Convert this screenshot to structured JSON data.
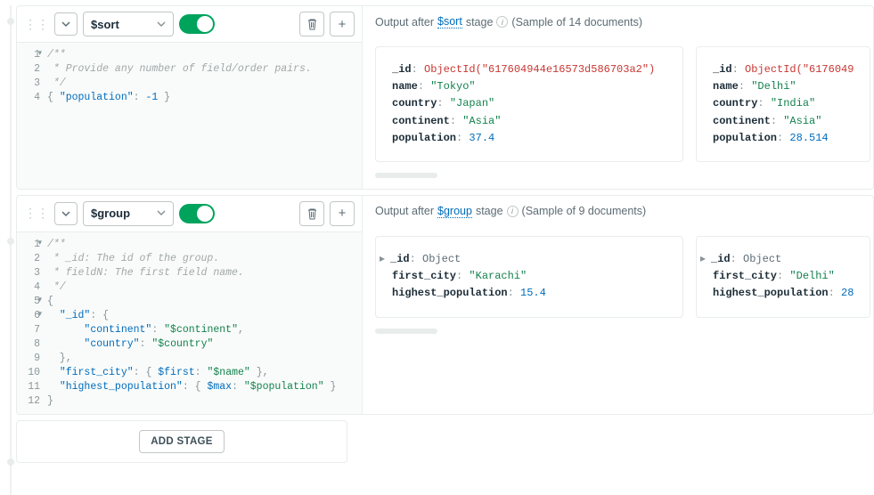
{
  "stages": [
    {
      "operator": "$sort",
      "output_label_prefix": "Output after",
      "output_label_stage": "$sort",
      "output_label_suffix": "stage",
      "sample_text": "(Sample of 14 documents)",
      "code_lines": [
        {
          "n": "1",
          "fold": true,
          "frags": [
            {
              "t": "/**",
              "c": "tok-comment"
            }
          ]
        },
        {
          "n": "2",
          "frags": [
            {
              "t": " * Provide any number of field/order pairs.",
              "c": "tok-comment"
            }
          ]
        },
        {
          "n": "3",
          "frags": [
            {
              "t": " */",
              "c": "tok-comment"
            }
          ]
        },
        {
          "n": "4",
          "frags": [
            {
              "t": "{ ",
              "c": "tok-punct"
            },
            {
              "t": "\"population\"",
              "c": "tok-key"
            },
            {
              "t": ": ",
              "c": "tok-punct"
            },
            {
              "t": "-1",
              "c": "tok-num"
            },
            {
              "t": " }",
              "c": "tok-punct"
            }
          ]
        }
      ],
      "docs": [
        {
          "fields": [
            {
              "k": "_id",
              "colon": ":",
              "v": "ObjectId(\"617604944e16573d586703a2\")",
              "vc": "fv-oid"
            },
            {
              "k": "name",
              "colon": ":",
              "v": "\"Tokyo\"",
              "vc": "fv-str"
            },
            {
              "k": "country",
              "colon": ":",
              "v": "\"Japan\"",
              "vc": "fv-str"
            },
            {
              "k": "continent",
              "colon": ":",
              "v": "\"Asia\"",
              "vc": "fv-str"
            },
            {
              "k": "population",
              "colon": ":",
              "v": "37.4",
              "vc": "fv-num"
            }
          ]
        },
        {
          "fields": [
            {
              "k": "_id",
              "colon": ":",
              "v": "ObjectId(\"6176049",
              "vc": "fv-oid"
            },
            {
              "k": "name",
              "colon": ":",
              "v": "\"Delhi\"",
              "vc": "fv-str"
            },
            {
              "k": "country",
              "colon": ":",
              "v": "\"India\"",
              "vc": "fv-str"
            },
            {
              "k": "continent",
              "colon": ":",
              "v": "\"Asia\"",
              "vc": "fv-str"
            },
            {
              "k": "population",
              "colon": ":",
              "v": "28.514",
              "vc": "fv-num"
            }
          ]
        }
      ]
    },
    {
      "operator": "$group",
      "output_label_prefix": "Output after",
      "output_label_stage": "$group",
      "output_label_suffix": "stage",
      "sample_text": "(Sample of 9 documents)",
      "code_lines": [
        {
          "n": "1",
          "fold": true,
          "frags": [
            {
              "t": "/**",
              "c": "tok-comment"
            }
          ]
        },
        {
          "n": "2",
          "frags": [
            {
              "t": " * _id: The id of the group.",
              "c": "tok-comment"
            }
          ]
        },
        {
          "n": "3",
          "frags": [
            {
              "t": " * fieldN: The first field name.",
              "c": "tok-comment"
            }
          ]
        },
        {
          "n": "4",
          "frags": [
            {
              "t": " */",
              "c": "tok-comment"
            }
          ]
        },
        {
          "n": "5",
          "fold": true,
          "frags": [
            {
              "t": "{",
              "c": "tok-punct"
            }
          ]
        },
        {
          "n": "6",
          "fold": true,
          "frags": [
            {
              "t": "  ",
              "c": ""
            },
            {
              "t": "\"_id\"",
              "c": "tok-key"
            },
            {
              "t": ": {",
              "c": "tok-punct"
            }
          ]
        },
        {
          "n": "7",
          "frags": [
            {
              "t": "      ",
              "c": ""
            },
            {
              "t": "\"continent\"",
              "c": "tok-key"
            },
            {
              "t": ": ",
              "c": "tok-punct"
            },
            {
              "t": "\"$continent\"",
              "c": "tok-str"
            },
            {
              "t": ",",
              "c": "tok-punct"
            }
          ]
        },
        {
          "n": "8",
          "frags": [
            {
              "t": "      ",
              "c": ""
            },
            {
              "t": "\"country\"",
              "c": "tok-key"
            },
            {
              "t": ": ",
              "c": "tok-punct"
            },
            {
              "t": "\"$country\"",
              "c": "tok-str"
            }
          ]
        },
        {
          "n": "9",
          "frags": [
            {
              "t": "  },",
              "c": "tok-punct"
            }
          ]
        },
        {
          "n": "10",
          "frags": [
            {
              "t": "  ",
              "c": ""
            },
            {
              "t": "\"first_city\"",
              "c": "tok-key"
            },
            {
              "t": ": { ",
              "c": "tok-punct"
            },
            {
              "t": "$first",
              "c": "tok-key"
            },
            {
              "t": ": ",
              "c": "tok-punct"
            },
            {
              "t": "\"$name\"",
              "c": "tok-str"
            },
            {
              "t": " },",
              "c": "tok-punct"
            }
          ]
        },
        {
          "n": "11",
          "frags": [
            {
              "t": "  ",
              "c": ""
            },
            {
              "t": "\"highest_population\"",
              "c": "tok-key"
            },
            {
              "t": ": { ",
              "c": "tok-punct"
            },
            {
              "t": "$max",
              "c": "tok-key"
            },
            {
              "t": ": ",
              "c": "tok-punct"
            },
            {
              "t": "\"$population\"",
              "c": "tok-str"
            },
            {
              "t": " }",
              "c": "tok-punct"
            }
          ]
        },
        {
          "n": "12",
          "frags": [
            {
              "t": "}",
              "c": "tok-punct"
            }
          ]
        }
      ],
      "docs": [
        {
          "fields": [
            {
              "k": "_id",
              "colon": ":",
              "v": "Object",
              "vc": "fv-type",
              "expand": true
            },
            {
              "k": "first_city",
              "colon": ":",
              "v": "\"Karachi\"",
              "vc": "fv-str"
            },
            {
              "k": "highest_population",
              "colon": ":",
              "v": "15.4",
              "vc": "fv-num"
            }
          ]
        },
        {
          "fields": [
            {
              "k": "_id",
              "colon": ":",
              "v": "Object",
              "vc": "fv-type",
              "expand": true
            },
            {
              "k": "first_city",
              "colon": ":",
              "v": "\"Delhi\"",
              "vc": "fv-str"
            },
            {
              "k": "highest_population",
              "colon": ":",
              "v": "28",
              "vc": "fv-num"
            }
          ]
        }
      ]
    }
  ],
  "add_stage_label": "ADD STAGE"
}
